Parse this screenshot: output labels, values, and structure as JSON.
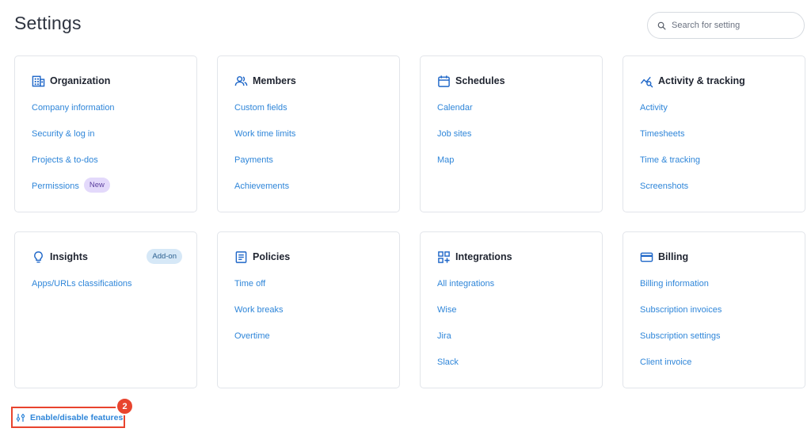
{
  "page": {
    "title": "Settings"
  },
  "search": {
    "placeholder": "Search for setting"
  },
  "cards": {
    "organization": {
      "title": "Organization",
      "links": [
        "Company information",
        "Security & log in",
        "Projects & to-dos",
        "Permissions"
      ],
      "badge": "New"
    },
    "members": {
      "title": "Members",
      "links": [
        "Custom fields",
        "Work time limits",
        "Payments",
        "Achievements"
      ]
    },
    "schedules": {
      "title": "Schedules",
      "links": [
        "Calendar",
        "Job sites",
        "Map"
      ]
    },
    "activity": {
      "title": "Activity & tracking",
      "links": [
        "Activity",
        "Timesheets",
        "Time & tracking",
        "Screenshots"
      ]
    },
    "insights": {
      "title": "Insights",
      "badge": "Add-on",
      "links": [
        "Apps/URLs classifications"
      ]
    },
    "policies": {
      "title": "Policies",
      "links": [
        "Time off",
        "Work breaks",
        "Overtime"
      ]
    },
    "integrations": {
      "title": "Integrations",
      "links": [
        "All integrations",
        "Wise",
        "Jira",
        "Slack"
      ]
    },
    "billing": {
      "title": "Billing",
      "links": [
        "Billing information",
        "Subscription invoices",
        "Subscription settings",
        "Client invoice"
      ]
    }
  },
  "footer": {
    "features_label": "Enable/disable features",
    "count": "2"
  },
  "colors": {
    "link": "#2f86d9",
    "icon": "#1f67c8",
    "annotation": "#e8442e",
    "badge_new_bg": "#e3d9fb",
    "badge_addon_bg": "#d6e8f7"
  },
  "icons": {
    "organization": "building-icon",
    "members": "users-icon",
    "schedules": "calendar-icon",
    "activity": "activity-chart-icon",
    "insights": "lightbulb-icon",
    "policies": "document-icon",
    "integrations": "grid-plus-icon",
    "billing": "credit-card-icon",
    "search": "search-icon",
    "features": "sliders-icon"
  }
}
